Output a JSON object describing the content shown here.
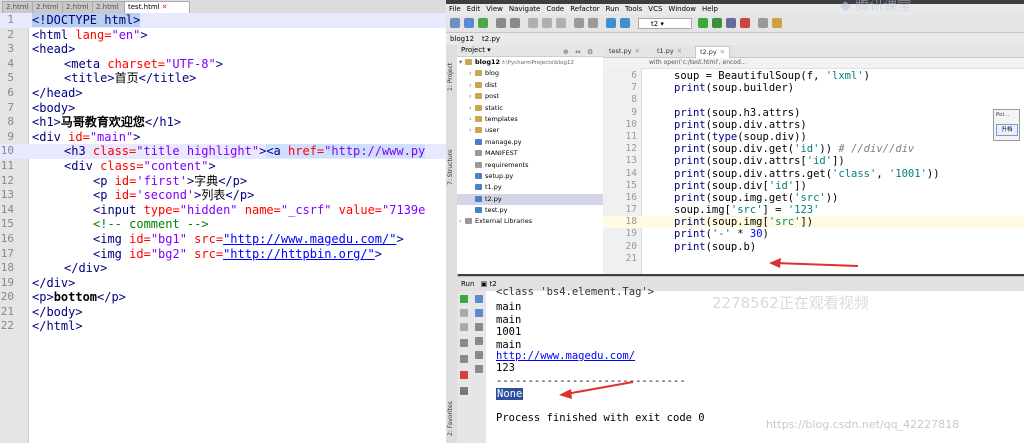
{
  "left_editor": {
    "tabs": [
      {
        "label": "2.html",
        "active": false
      },
      {
        "label": "2.html",
        "active": false
      },
      {
        "label": "2.html",
        "active": false
      },
      {
        "label": "2.html",
        "active": false
      },
      {
        "label": "test.html",
        "active": true
      }
    ],
    "lines": [
      {
        "n": "1"
      },
      {
        "n": "2"
      },
      {
        "n": "3"
      },
      {
        "n": "4"
      },
      {
        "n": "5"
      },
      {
        "n": "6"
      },
      {
        "n": "7"
      },
      {
        "n": "8"
      },
      {
        "n": "9"
      },
      {
        "n": "10"
      },
      {
        "n": "11"
      },
      {
        "n": "12"
      },
      {
        "n": "13"
      },
      {
        "n": "14"
      },
      {
        "n": "15"
      },
      {
        "n": "16"
      },
      {
        "n": "17"
      },
      {
        "n": "18"
      },
      {
        "n": "19"
      },
      {
        "n": "20"
      },
      {
        "n": "21"
      },
      {
        "n": "22"
      }
    ],
    "t": {
      "doctype": "<!DOCTYPE html>",
      "html_open": "<html",
      "lang_attr": " lang=",
      "lang_val": "\"en\"",
      "gt": ">",
      "head_open": "<head>",
      "meta": "<meta",
      "charset_attr": " charset=",
      "charset_val": "\"UTF-8\"",
      "title_open": "<title>",
      "title_text": "首页",
      "title_close": "</title>",
      "head_close": "</head>",
      "body_open": "<body>",
      "h1_open": "<h1>",
      "h1_text": "马哥教育欢迎您",
      "h1_close": "</h1>",
      "div": "<div",
      "id_attr": " id=",
      "main_val": "\"main\"",
      "h3": "<h3",
      "class_attr": " class=",
      "title_hl_val": "\"title highlight\"",
      "a_open": "<a",
      "href_attr": " href=",
      "href_val": "\"http://www.py",
      "content_val": "\"content\"",
      "p": "<p",
      "first_val": "'first'",
      "zidian": "字典",
      "p_close": "</p>",
      "second_val": "'second'",
      "liebiao": "列表",
      "input": "<input",
      "type_attr": " type=",
      "hidden_val": "\"hidden\"",
      "name_attr": " name=",
      "csrf_val": "\"_csrf\"",
      "value_attr": " value=",
      "value_val": "\"7139e",
      "comment": "<!-- comment -->",
      "img": "<img",
      "bg1_val": "\"bg1\"",
      "src_attr": " src=",
      "src1": "\"http://www.magedu.com/\"",
      "bg2_val": "\"bg2\"",
      "src2": "\"http://httpbin.org/\"",
      "div_close": "</div>",
      "p_open": "<p>",
      "bottom": "bottom",
      "body_close": "</body>",
      "html_close": "</html>"
    }
  },
  "ide": {
    "menu": [
      "File",
      "Edit",
      "View",
      "Navigate",
      "Code",
      "Refactor",
      "Run",
      "Tools",
      "VCS",
      "Window",
      "Help"
    ],
    "run_config": "t2",
    "nav": [
      "blog12",
      "t2.py"
    ],
    "project": {
      "header": "Project",
      "root": "blog12",
      "root_path": "f:\\PycharmProjects\\blog12",
      "items": [
        {
          "label": "blog",
          "kind": "folder"
        },
        {
          "label": "dist",
          "kind": "folder"
        },
        {
          "label": "post",
          "kind": "folder"
        },
        {
          "label": "static",
          "kind": "folder"
        },
        {
          "label": "templates",
          "kind": "folder"
        },
        {
          "label": "user",
          "kind": "folder"
        },
        {
          "label": "manage.py",
          "kind": "py"
        },
        {
          "label": "MANIFEST",
          "kind": "txt"
        },
        {
          "label": "requirements",
          "kind": "txt"
        },
        {
          "label": "setup.py",
          "kind": "py"
        },
        {
          "label": "t1.py",
          "kind": "py"
        },
        {
          "label": "t2.py",
          "kind": "py"
        },
        {
          "label": "test.py",
          "kind": "py"
        }
      ],
      "external": "External Libraries"
    },
    "editor_tabs": [
      "test.py",
      "t1.py",
      "t2.py"
    ],
    "breadcrumb": "with open('c:/test.html', encod...",
    "code_lines": [
      {
        "n": "6"
      },
      {
        "n": "7"
      },
      {
        "n": "8"
      },
      {
        "n": "9"
      },
      {
        "n": "10"
      },
      {
        "n": "11"
      },
      {
        "n": "12"
      },
      {
        "n": "13"
      },
      {
        "n": "14"
      },
      {
        "n": "15"
      },
      {
        "n": "16"
      },
      {
        "n": "17"
      },
      {
        "n": "18"
      },
      {
        "n": "19"
      },
      {
        "n": "20"
      },
      {
        "n": "21"
      }
    ],
    "c": {
      "l6a": "soup = BeautifulSoup(f, ",
      "l6b": "'lxml'",
      "l6c": ")",
      "pr": "print",
      "l7": "(soup.builder)",
      "l9": "(soup.h3.attrs)",
      "l10": "(soup.div.attrs)",
      "l11a": "(",
      "l11b": "type",
      "l11c": "(soup.div))",
      "l12a": "(soup.div.get(",
      "l12b": "'id'",
      "l12c": ")) ",
      "l12d": "# //div//div",
      "l13a": "(soup.div.attrs[",
      "l13c": "])",
      "l14a": "(soup.div.attrs.get(",
      "l14b": "'class'",
      "l14c": ", ",
      "l14d": "'1001'",
      "l14e": "))",
      "l15a": "(soup.div[",
      "l16a": "(soup.img.get(",
      "l16b": "'src'",
      "l16c": "))",
      "l17a": "soup.img[",
      "l17c": "] = ",
      "l17d": "'123'",
      "l18a": "(soup.img[",
      "l19a": "(",
      "l19b": "'-'",
      "l19c": " * ",
      "l19d": "30",
      "l19e": ")",
      "l20": "(soup.b)"
    },
    "run_tab": "t2",
    "console_lines": [
      "<class 'bs4.element.Tag'>",
      "main",
      "main",
      "1001",
      "main",
      "http://www.magedu.com/",
      "123",
      "------------------------------",
      "None",
      "Process finished with exit code 0"
    ],
    "side_labels": [
      "1: Project",
      "7: Structure",
      "2: Favorites"
    ]
  },
  "overlay": {
    "watermark_viewers": "2278562正在观看视频",
    "watermark_url": "https://blog.csdn.net/qq_42227818",
    "logo_text": "腾讯课堂",
    "popup_title": "Poi...",
    "popup_button": "升档"
  },
  "colors": {
    "arrow": "#e03030",
    "tag": "#000080",
    "attribute": "#ff0000",
    "string": "#8000ff",
    "comment": "#008000"
  }
}
